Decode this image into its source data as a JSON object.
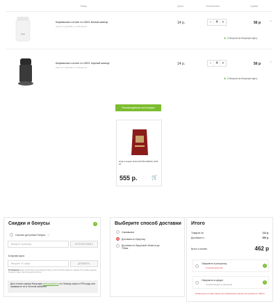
{
  "table_headers": {
    "product": "Товар",
    "price": "Цена",
    "quantity": "Количество",
    "sum": "Сумма"
  },
  "items": [
    {
      "name": "Кофемолка Lumme LU-2601 Белый жемчуг",
      "meta": "Удалить | Добавить в избранное",
      "price": "14 р.",
      "qty": "4",
      "sum": "56 р",
      "bonus": "6 бонусов на бонусную карту"
    },
    {
      "name": "Кофемолка Lumme LU-2601 Черный жемчуг",
      "meta": "Удалить | Добавить в избранное",
      "price": "14 р.",
      "qty": "4",
      "sum": "56 р",
      "bonus": "6 бонусов на бонусную карту"
    }
  ],
  "recommended_button": "Рекомендуемые аксессуары",
  "accessory": {
    "name": "Кофе в зернах Kimbo EXTRA CREAM, 1000 ГР",
    "price": "555 р."
  },
  "discounts": {
    "title": "Скидки и бонусы",
    "spend_label": "Списать доступные бонусы",
    "promo_placeholder": "Введите промокод",
    "apply_label": "ИСПОЛЬЗОВАТЬ",
    "card_label": "Бонусная карта",
    "card_placeholder": "Введите 19 цифр",
    "add_label": "ДОБАВИТЬ",
    "bonus_note_bold": "12 бонусов",
    "bonus_note": "будет начислено на бонусную карту после оплаты данного заказа. В течение недели бонусы станут доступны для оплаты",
    "info_pre": "Для оплаты заказа бонусами ",
    "info_link": "авторизуйтесь",
    "info_post": " по Номеру карты и PIN-коду или привяжите ее в Личном кабинете"
  },
  "delivery": {
    "title": "Выберите способ доставки",
    "options": [
      "Самовывоз",
      "Доставка по Иркутску",
      "Доставка по Иркутской области до 700км"
    ]
  },
  "total": {
    "title": "Итого",
    "goods_label": "Товаров на",
    "goods_value": "112 р.",
    "delivery_label": "Доставка от",
    "delivery_value": "350 р.",
    "pay_label": "Всего к оплате",
    "pay_value": "462 р",
    "installment": "Оформить в рассрочку",
    "installment_sub": "Условия рассрочки",
    "credit": "Оформить в кредит",
    "credit_sub": "Условия кредита и рассрочки",
    "warning": "Уникальные составы заказа для оформления покупки на приоритете: 3000 р."
  }
}
